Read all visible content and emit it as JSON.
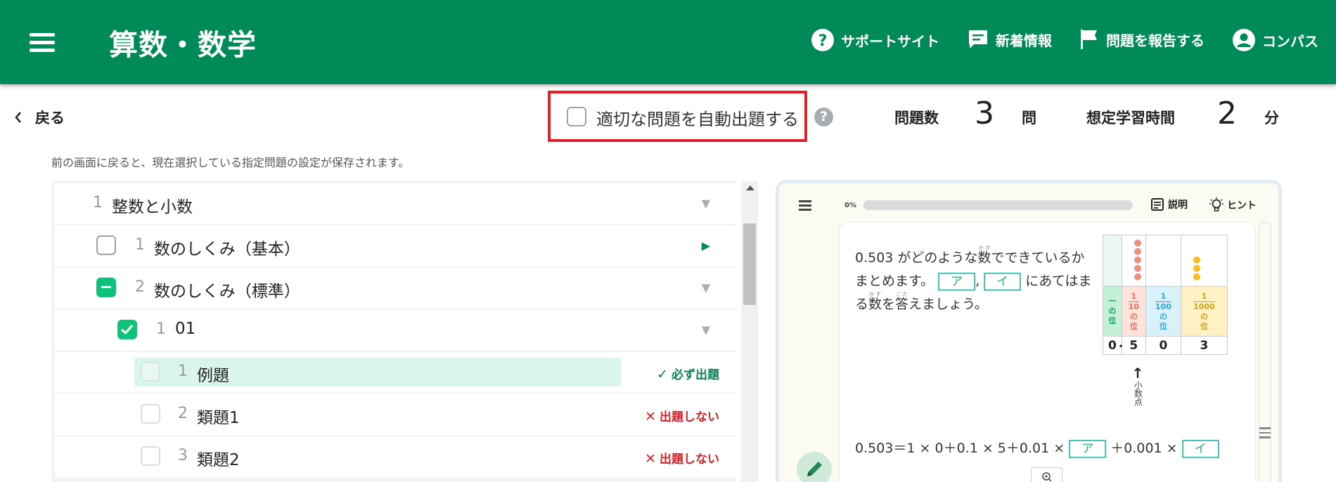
{
  "header": {
    "title": "算数・数学",
    "nav": {
      "support": "サポートサイト",
      "news": "新着情報",
      "report": "問題を報告する",
      "account": "コンパス"
    },
    "color": "#008a57"
  },
  "toolbar": {
    "back": "戻る",
    "auto_label": "適切な問題を自動出題する",
    "auto_checked": false,
    "help": "?",
    "count_label": "問題数",
    "count_value": "3",
    "count_unit": "問",
    "time_label": "想定学習時間",
    "time_value": "2",
    "time_unit": "分"
  },
  "note": "前の画面に戻ると、現在選択している指定問題の設定が保存されます。",
  "tree": {
    "rows": [
      {
        "num": "1",
        "label": "整数と小数",
        "state": "none",
        "expanded": true
      },
      {
        "num": "1",
        "label": "数のしくみ（基本）",
        "state": "unchecked",
        "expanded": false
      },
      {
        "num": "2",
        "label": "数のしくみ（標準）",
        "state": "partial",
        "expanded": true
      },
      {
        "num": "1",
        "label": "01",
        "state": "checked",
        "expanded": true
      },
      {
        "num": "1",
        "label": "例題",
        "state": "disabled",
        "status": "必ず出題",
        "status_mark": "✓"
      },
      {
        "num": "2",
        "label": "類題1",
        "state": "unchecked",
        "status": "出題しない",
        "status_mark": "✕"
      },
      {
        "num": "3",
        "label": "類題2",
        "state": "unchecked",
        "status": "出題しない",
        "status_mark": "✕"
      }
    ]
  },
  "preview": {
    "progress_label": "0%",
    "progress": 0,
    "explain": "説明",
    "hint": "ヒント",
    "question": {
      "part1": "0.503 がどのような",
      "kazu": "数",
      "kazu_ruby": "かず",
      "part2": "でできているかまとめます。",
      "box_a": "ア",
      "comma": ",",
      "box_i": "イ",
      "part3": "にあてはまる",
      "part4": "を",
      "kota": "答",
      "kota_ruby": "こた",
      "part5": "えましょう。"
    },
    "table": {
      "places": [
        "一の位",
        "1/10の位",
        "1/100の位",
        "1/1000の位"
      ],
      "digits": [
        "0",
        "5",
        "0",
        "3"
      ],
      "decimal_point": ".",
      "point_label": "小数点",
      "colors": [
        "#e3f6ec",
        "#fde6e1",
        "#e0f4fb",
        "#fff5d6"
      ]
    },
    "equation": {
      "text": "0.503＝1 × 0＋0.1 × 5＋0.01 ×",
      "box_a": "ア",
      "mid": "＋0.001 ×",
      "box_i": "イ"
    }
  }
}
